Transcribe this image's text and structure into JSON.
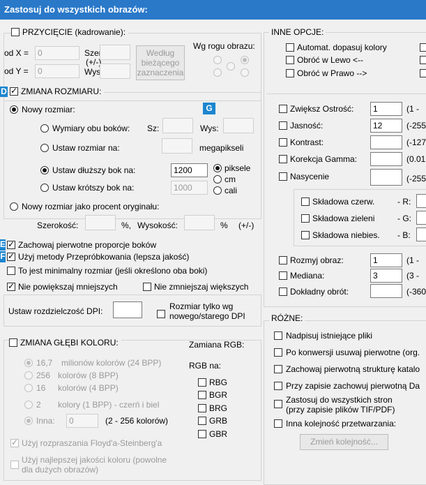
{
  "title": "Zastosuj do wszystkich obrazów:",
  "badges": {
    "d": "D",
    "g": "G",
    "e": "E",
    "f": "F"
  },
  "crop": {
    "label": "PRZYCIĘCIE  (kadrowanie):",
    "odx_label": "od X =",
    "odx_value": "0",
    "ody_label": "od Y =",
    "ody_value": "0",
    "szer_label": "Szer.:",
    "pm_label": "(+/-)",
    "wys_label": "Wys.:",
    "btn_lines": [
      "Według",
      "bieżącego",
      "zaznaczenia"
    ],
    "corner_label": "Wg rogu obrazu:"
  },
  "resize": {
    "label": "ZMIANA ROZMIARU:",
    "new_size": "Nowy rozmiar:",
    "both_dims": "Wymiary obu boków:",
    "sz_label": "Sz:",
    "wys_label": "Wys:",
    "set_size": "Ustaw rozmiar na:",
    "megapixels": "megapikseli",
    "longer": "Ustaw dłuższy bok na:",
    "longer_value": "1200",
    "shorter": "Ustaw krótszy bok na:",
    "shorter_value": "1000",
    "units": [
      "piksele",
      "cm",
      "cali"
    ],
    "percent": "Nowy rozmiar jako procent oryginału:",
    "width_label": "Szerokość:",
    "pct1": "%,",
    "height_label": "Wysokość:",
    "pct2": "%",
    "pm": "(+/-)"
  },
  "options": {
    "keep_ratio": "Zachowaj pierwotne proporcje boków",
    "resample": "Użyj metody Przepróbkowania (lepsza jakość)",
    "minimal": "To jest minimalny rozmiar (jeśli określono oba boki)",
    "no_enlarge": "Nie powiększaj mniejszych",
    "no_shrink": "Nie zmniejszaj większych",
    "dpi_label": "Ustaw rozdzielczość DPI:",
    "size_only_lines": [
      "Rozmiar tylko wg",
      "nowego/starego DPI"
    ]
  },
  "color_depth": {
    "label": "ZMIANA GŁĘBI KOLORU:",
    "items": [
      {
        "a": "16,7",
        "b": "milionów kolorów (24 BPP)"
      },
      {
        "a": "256",
        "b": "kolorów (8 BPP)"
      },
      {
        "a": "16",
        "b": "kolorów (4 BPP)"
      },
      {
        "a": "2",
        "b": "kolory (1 BPP) - czerń i biel"
      }
    ],
    "other_label": "Inna:",
    "other_value": "0",
    "other_range": "(2 - 256 kolorów)",
    "dither": "Użyj rozpraszania Floyd'a-Steinberg'a",
    "best_lines": [
      "Użyj najlepszej jakości koloru (powolne",
      "dla dużych obrazów)"
    ]
  },
  "rgb": {
    "label": "Zamiana RGB:",
    "sub": "RGB na:",
    "items": [
      "RBG",
      "BGR",
      "BRG",
      "GRB",
      "GBR"
    ]
  },
  "other_opts": {
    "label": "INNE OPCJE:",
    "auto_colors": "Automat. dopasuj kolory",
    "rot_left": "Obróć w Lewo  <--",
    "rot_right": "Obróć w Prawo  -->",
    "sharpen": "Zwiększ Ostrość:",
    "sharpen_value": "1",
    "sharpen_range": "(1 -",
    "brightness": "Jasność:",
    "brightness_value": "12",
    "brightness_range": "(-255",
    "contrast": "Kontrast:",
    "contrast_range": "(-127",
    "gamma": "Korekcja Gamma:",
    "gamma_range": "(0.01",
    "saturation": "Nasycenie",
    "saturation_range": "(-255",
    "red": "Składowa czerw.",
    "r_label": "- R:",
    "green": "Składowa zieleni",
    "g_label": "- G:",
    "blue": "Składowa niebies.",
    "b_label": "- B:",
    "blur": "Rozmyj obraz:",
    "blur_value": "1",
    "blur_range": "(1 -",
    "median": "Mediana:",
    "median_value": "3",
    "median_range": "(3 -",
    "rotate": "Dokładny obrót:",
    "rotate_range": "(-360"
  },
  "misc": {
    "label": "RÓŻNE:",
    "overwrite": "Nadpisuj istniejące pliki",
    "delete_orig": "Po konwersji usuwaj pierwotne (org.",
    "keep_folders": "Zachowaj pierwotną strukturę katalo",
    "keep_date": "Przy zapisie zachowuj pierwotną Da",
    "all_pages_lines": [
      "Zastosuj do wszystkich stron",
      "(przy zapisie plików TIF/PDF)"
    ],
    "order": "Inna kolejność przetwarzania:",
    "change_order": "Zmień kolejność..."
  }
}
